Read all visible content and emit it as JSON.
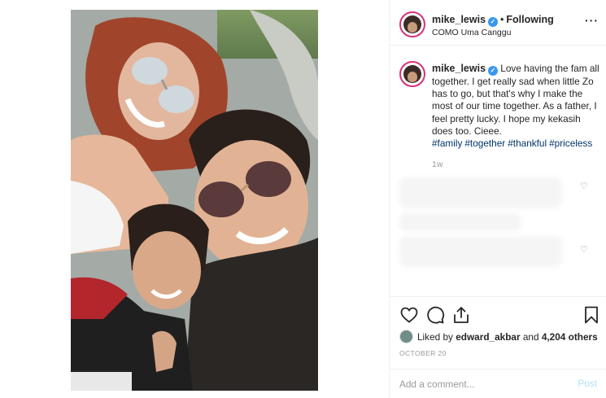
{
  "header": {
    "username": "mike_lewis",
    "separator": "•",
    "follow_label": "Following",
    "location": "COMO Uma Canggu",
    "more_icon": "ellipsis-icon"
  },
  "caption": {
    "username": "mike_lewis",
    "text": "Love having the fam all together. I get really sad when little Zo has to go, but that's why I make the most of our time together. As a father, I feel pretty lucky. I hope my kekasih does too. Cieee.",
    "hashtags": [
      "#family",
      "#together",
      "#thankful",
      "#priceless"
    ],
    "time_ago": "1w"
  },
  "actions": {
    "icons": [
      "heart-icon",
      "comment-icon",
      "share-icon",
      "bookmark-icon"
    ]
  },
  "likes": {
    "prefix": "Liked by",
    "user": "edward_akbar",
    "middle": "and",
    "count": "4,204 others"
  },
  "date": "OCTOBER 20",
  "comment": {
    "placeholder": "Add a comment...",
    "post_label": "Post"
  },
  "colors": {
    "verified": "#3897f0",
    "hashtag": "#003569",
    "story_ring": "#d9317a",
    "post_button_disabled": "#b2dffc"
  }
}
